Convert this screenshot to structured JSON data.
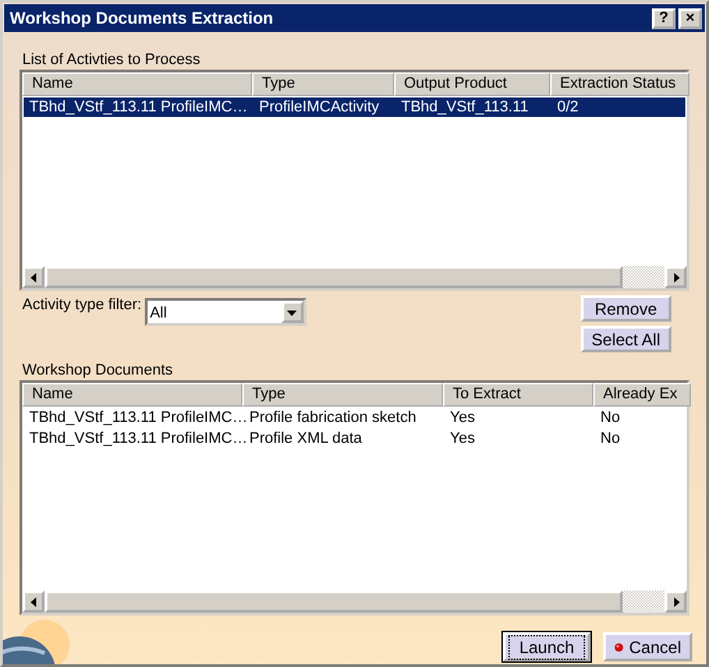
{
  "window": {
    "title": "Workshop Documents Extraction",
    "buttons": [
      "?",
      "×"
    ]
  },
  "activities": {
    "label": "List of Activties to Process",
    "columns": [
      "Name",
      "Type",
      "Output Product",
      "Extraction Status"
    ],
    "rows": [
      {
        "cells": [
          "TBhd_VStf_113.11 ProfileIMC…",
          "ProfileIMCActivity",
          "TBhd_VStf_113.11",
          "0/2"
        ],
        "selected": true
      }
    ]
  },
  "filter": {
    "label": "Activity type filter:",
    "value": "All"
  },
  "side_buttons": [
    "Remove",
    "Select All"
  ],
  "documents": {
    "label": "Workshop Documents",
    "columns": [
      "Name",
      "Type",
      "To Extract",
      "Already Ex"
    ],
    "rows": [
      {
        "cells": [
          "TBhd_VStf_113.11 ProfileIMC…",
          "Profile fabrication sketch",
          "Yes",
          "No"
        ],
        "selected": false
      },
      {
        "cells": [
          "TBhd_VStf_113.11 ProfileIMC…",
          "Profile XML data",
          "Yes",
          "No"
        ],
        "selected": false
      }
    ]
  },
  "footer_buttons": [
    {
      "label": "Launch",
      "kind": "default"
    },
    {
      "label": "Cancel",
      "kind": "cancel"
    }
  ]
}
